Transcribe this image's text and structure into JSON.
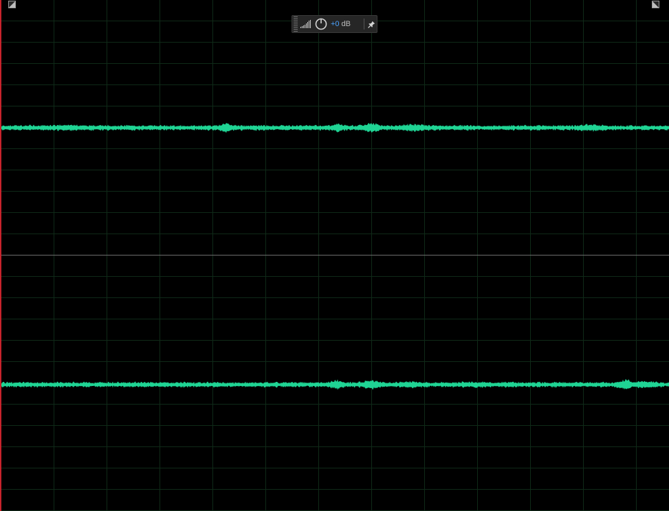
{
  "hud": {
    "volume_value": "+0",
    "volume_unit": "dB",
    "icons": {
      "level_meter": "signal-level-icon",
      "knob": "volume-knob-icon",
      "pin": "pin-icon"
    }
  },
  "toggles": {
    "left": "channel-toggle-left-icon",
    "right": "channel-toggle-right-icon"
  },
  "colors": {
    "background": "#000000",
    "waveform": "#1fd494",
    "playhead": "#c8232c",
    "grid": "#0f2a18",
    "divider": "#6e6e6e",
    "hud_value": "#4aa3ff"
  },
  "channels": [
    "left-channel",
    "right-channel"
  ]
}
